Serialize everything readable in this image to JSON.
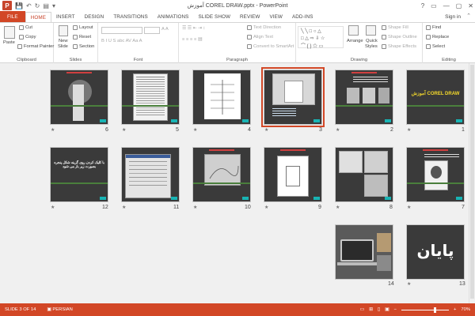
{
  "window": {
    "title": "آموزش COREL DRAW.pptx - PowerPoint",
    "app_icon": "P",
    "controls": [
      "?",
      "▭",
      "—",
      "▢",
      "✕"
    ]
  },
  "qat": {
    "save_icon": "💾",
    "undo_icon": "↶",
    "redo_icon": "↻",
    "start_icon": "▤",
    "more_icon": "▾"
  },
  "tabs": [
    "FILE",
    "HOME",
    "INSERT",
    "DESIGN",
    "TRANSITIONS",
    "ANIMATIONS",
    "SLIDE SHOW",
    "REVIEW",
    "VIEW",
    "ADD-INS"
  ],
  "active_tab": "HOME",
  "signin": "Sign in",
  "ribbon": {
    "clipboard": {
      "label": "Clipboard",
      "paste": "Paste",
      "cut": "Cut",
      "copy": "Copy",
      "format_painter": "Format Painter"
    },
    "slides": {
      "label": "Slides",
      "new_slide": "New",
      "new_slide_2": "Slide",
      "layout": "Layout",
      "reset": "Reset",
      "section": "Section"
    },
    "font": {
      "label": "Font",
      "letters": "B  I  U  S  abc  AV  Aa  A"
    },
    "paragraph": {
      "label": "Paragraph",
      "text_direction": "Text Direction",
      "align_text": "Align Text",
      "convert_smartart": "Convert to SmartArt"
    },
    "drawing": {
      "label": "Drawing",
      "arrange": "Arrange",
      "quick_styles": "Quick",
      "quick_styles_2": "Styles",
      "shape_fill": "Shape Fill",
      "shape_outline": "Shape Outline",
      "shape_effects": "Shape Effects"
    },
    "editing": {
      "label": "Editing",
      "find": "Find",
      "replace": "Replace",
      "select": "Select"
    }
  },
  "slides": [
    {
      "num": "1",
      "title": "آموزش COREL DRAW"
    },
    {
      "num": "2",
      "title": ""
    },
    {
      "num": "3",
      "title": ""
    },
    {
      "num": "4",
      "title": ""
    },
    {
      "num": "5",
      "title": ""
    },
    {
      "num": "6",
      "title": ""
    },
    {
      "num": "7",
      "title": ""
    },
    {
      "num": "8",
      "title": ""
    },
    {
      "num": "9",
      "title": ""
    },
    {
      "num": "10",
      "title": ""
    },
    {
      "num": "11",
      "title": ""
    },
    {
      "num": "12",
      "title": "با کلیک کردن روی گزینه شکل پنجره بصورت زیر باز می شود"
    },
    {
      "num": "13",
      "title": "پایان"
    },
    {
      "num": "14",
      "title": ""
    }
  ],
  "selected_slide": 3,
  "status": {
    "slide": "SLIDE 3 OF 14",
    "language": "PERSIAN",
    "zoom": "70%",
    "zoom_level": 0.7
  },
  "colors": {
    "accent": "#d24726",
    "slide_bg": "#3a3a3a",
    "slide_accent": "#18b4b4"
  }
}
